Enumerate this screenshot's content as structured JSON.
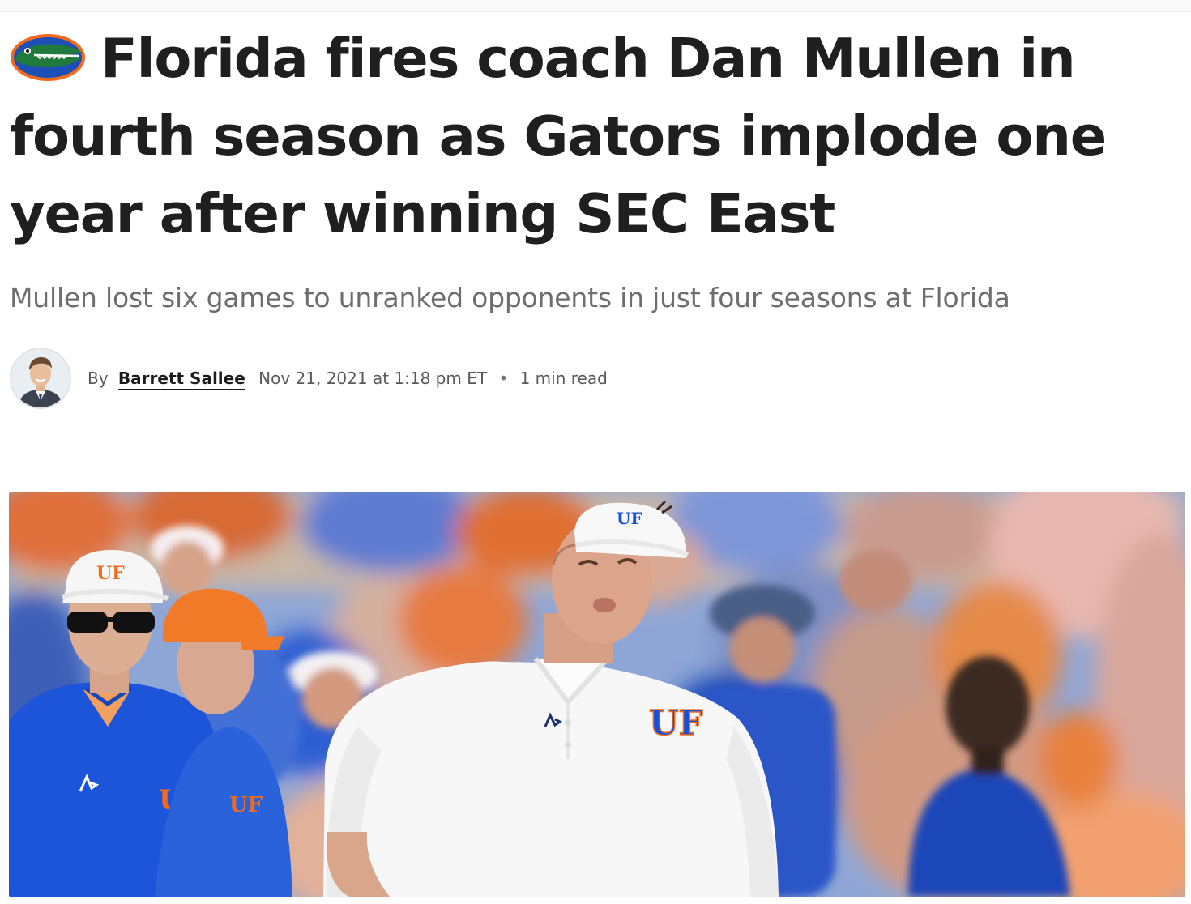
{
  "article": {
    "title": "Florida fires coach Dan Mullen in fourth season as Gators implode one year after winning SEC East",
    "subtitle": "Mullen lost six games to unranked opponents in just four seasons at Florida",
    "byline": {
      "prefix": "By",
      "author": "Barrett Sallee",
      "date": "Nov 21, 2021 at 1:18 pm ET",
      "separator": "•",
      "read_time": "1 min read"
    },
    "hero_image": {
      "shirt_logo": "UF",
      "visor_logo": "UF"
    }
  },
  "icons": {
    "team_logo": "florida-gators-logo-icon",
    "author_photo": "author-headshot"
  },
  "colors": {
    "text_primary": "#1f1f1f",
    "text_secondary": "#6e6e6e",
    "gator_green": "#1f7a3b",
    "gator_blue": "#1d4fb6",
    "gator_orange": "#f26b1d",
    "uf_royal_blue": "#1451d6"
  }
}
